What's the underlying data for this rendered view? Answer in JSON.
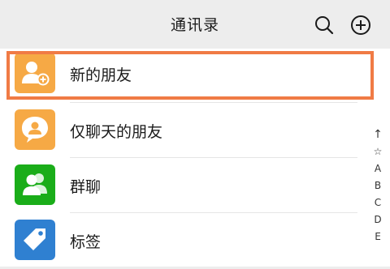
{
  "header": {
    "title": "通讯录",
    "search_icon": "search-icon",
    "add_icon": "add-circle-icon"
  },
  "contacts_menu": [
    {
      "label": "新的朋友",
      "icon": "add-friend-icon",
      "color": "#f6a945",
      "highlighted": true
    },
    {
      "label": "仅聊天的朋友",
      "icon": "chat-only-friend-icon",
      "color": "#f6a945"
    },
    {
      "label": "群聊",
      "icon": "group-chat-icon",
      "color": "#1aad19"
    },
    {
      "label": "标签",
      "icon": "tag-icon",
      "color": "#2f80d1"
    }
  ],
  "index_bar": [
    "↑",
    "☆",
    "A",
    "B",
    "C",
    "D",
    "E"
  ],
  "colors": {
    "highlight": "#f07b45",
    "header_bg": "#ededed",
    "list_bg": "#ffffff"
  }
}
